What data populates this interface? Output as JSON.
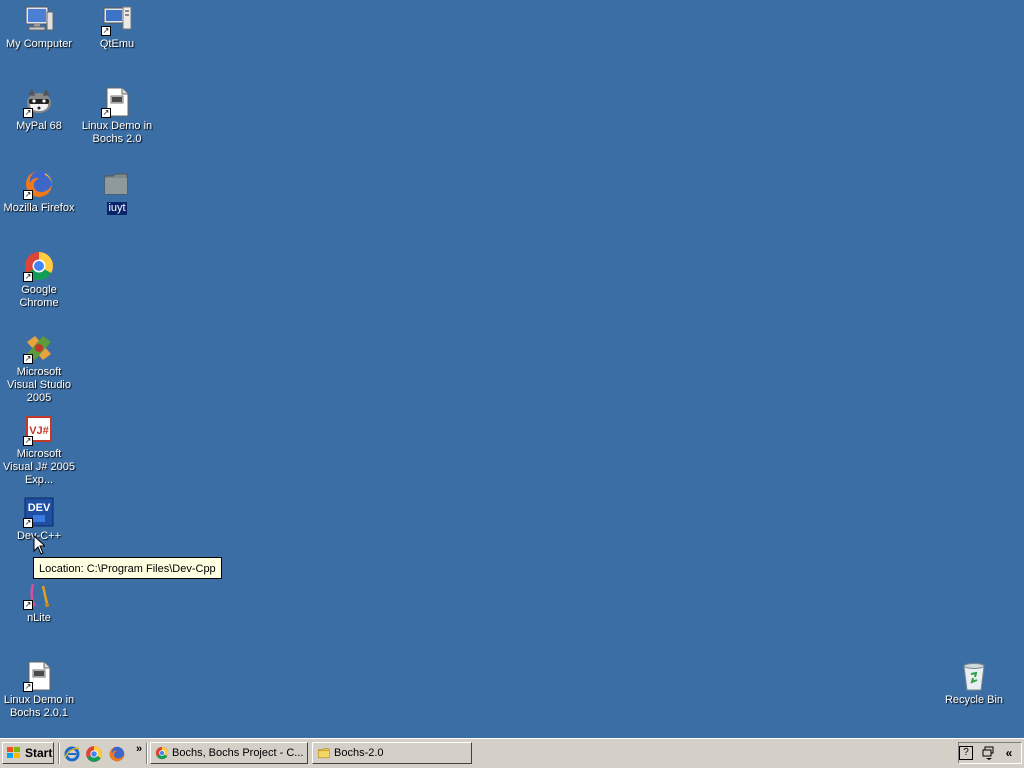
{
  "desktop": {
    "icons": [
      {
        "label": "My Computer",
        "icon": "computer-icon"
      },
      {
        "label": "QtEmu",
        "icon": "qtemu-icon"
      },
      {
        "label": "MyPal 68",
        "icon": "raccoon-icon"
      },
      {
        "label": "Linux Demo in Bochs 2.0",
        "icon": "document-icon"
      },
      {
        "label": "Mozilla Firefox",
        "icon": "firefox-icon"
      },
      {
        "label": "iuyt",
        "icon": "folder-icon"
      },
      {
        "label": "Google Chrome",
        "icon": "chrome-icon"
      },
      {
        "label": "Microsoft Visual Studio 2005",
        "icon": "visual-studio-icon"
      },
      {
        "label": "Microsoft Visual J# 2005 Exp...",
        "icon": "vjsharp-icon"
      },
      {
        "label": "Dev-C++",
        "icon": "devcpp-icon"
      },
      {
        "label": "nLite",
        "icon": "nlite-icon"
      },
      {
        "label": "Linux Demo in Bochs 2.0.1",
        "icon": "document-icon"
      },
      {
        "label": "Recycle Bin",
        "icon": "recycle-bin-icon"
      }
    ],
    "devcpp_badge": "DEV",
    "vj_badge": "VJ#",
    "tooltip": "Location: C:\\Program Files\\Dev-Cpp"
  },
  "taskbar": {
    "start_label": "Start",
    "overflow": "»",
    "tasks": [
      {
        "label": "Bochs, Bochs Project - C...",
        "icon": "chrome-icon"
      },
      {
        "label": "Bochs-2.0",
        "icon": "folder-icon"
      }
    ],
    "tray": {
      "help": "?",
      "collapse": "«"
    }
  },
  "colors": {
    "desktop": "#3a6ea5",
    "taskbar": "#d4d0c8",
    "selection": "#0a246a",
    "tooltip": "#ffffe1"
  }
}
